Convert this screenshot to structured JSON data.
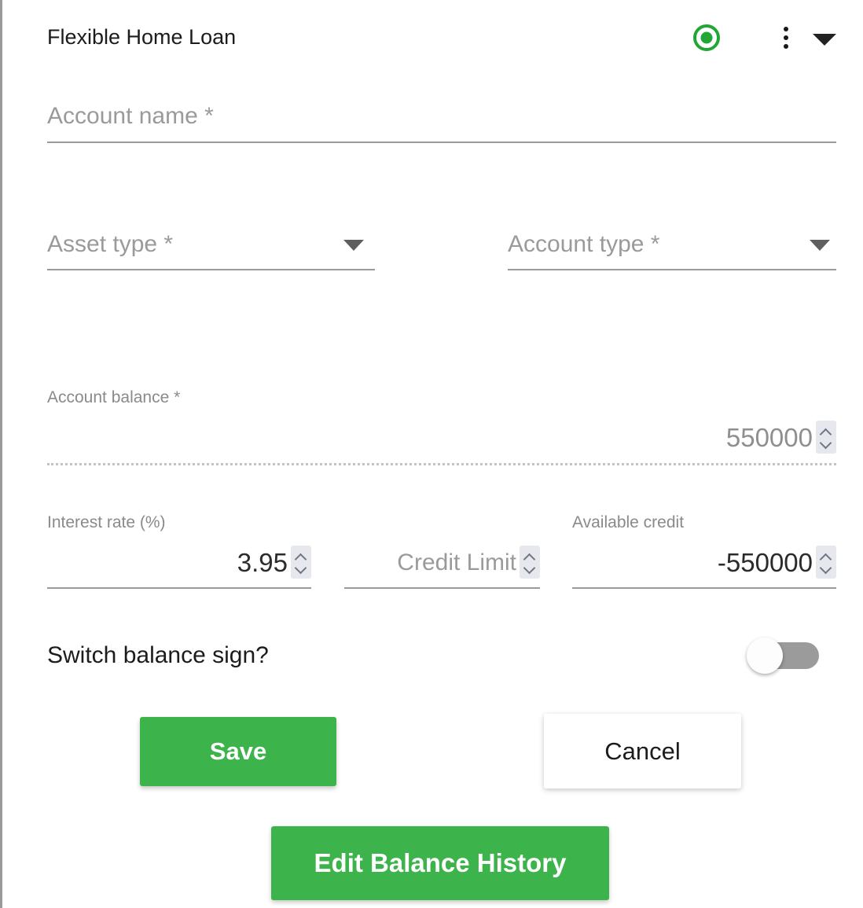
{
  "header": {
    "title": "Flexible Home Loan",
    "status_icon": "active-radio-icon",
    "status_color": "#22a737",
    "menu_icon": "more-vertical-icon",
    "expand_icon": "chevron-down-icon"
  },
  "fields": {
    "account_name": {
      "placeholder": "Account name *",
      "value": ""
    },
    "asset_type": {
      "placeholder": "Asset type *",
      "value": "",
      "caret_icon": "caret-down-icon"
    },
    "account_type": {
      "placeholder": "Account type *",
      "value": "",
      "caret_icon": "caret-down-icon"
    },
    "account_balance": {
      "label": "Account balance *",
      "value": "550000",
      "spinner_icon": "spinner-arrows-icon"
    },
    "interest_rate": {
      "label": "Interest rate (%)",
      "value": "3.95",
      "spinner_icon": "spinner-arrows-icon"
    },
    "credit_limit": {
      "label": "",
      "placeholder": "Credit Limit",
      "value": "",
      "spinner_icon": "spinner-arrows-icon"
    },
    "available_credit": {
      "label": "Available credit",
      "value": "-550000",
      "spinner_icon": "spinner-arrows-icon"
    }
  },
  "toggle": {
    "label": "Switch balance sign?",
    "state": "off"
  },
  "buttons": {
    "save": "Save",
    "cancel": "Cancel",
    "edit_history": "Edit Balance History"
  },
  "colors": {
    "accent_green": "#3cb34b",
    "status_green": "#22a737",
    "toggle_track": "#9b9b9b",
    "label_grey": "#8a8a8a"
  }
}
